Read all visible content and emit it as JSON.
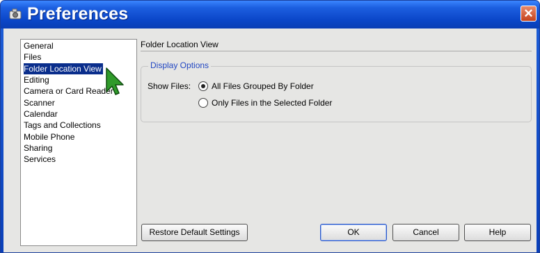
{
  "window": {
    "title": "Preferences",
    "close_glyph": "✕"
  },
  "nav": {
    "items": [
      {
        "label": "General"
      },
      {
        "label": "Files"
      },
      {
        "label": "Folder Location View",
        "selected": true
      },
      {
        "label": "Editing"
      },
      {
        "label": "Camera or Card Reader"
      },
      {
        "label": "Scanner"
      },
      {
        "label": "Calendar"
      },
      {
        "label": "Tags and Collections"
      },
      {
        "label": "Mobile Phone"
      },
      {
        "label": "Sharing"
      },
      {
        "label": "Services"
      }
    ]
  },
  "pane": {
    "title": "Folder Location View",
    "group_label": "Display Options",
    "show_files_label": "Show Files:",
    "options": [
      {
        "label": "All Files Grouped By Folder",
        "checked": true
      },
      {
        "label": "Only Files in the Selected Folder",
        "checked": false
      }
    ]
  },
  "buttons": {
    "restore": "Restore Default Settings",
    "ok": "OK",
    "cancel": "Cancel",
    "help": "Help"
  },
  "colors": {
    "titlebar": "#0b46c8",
    "selection": "#0a2e8c",
    "group_label": "#2146c2",
    "close": "#c4421c"
  },
  "icons": {
    "app": "camera-icon",
    "close": "close-icon",
    "pointer": "mouse-pointer-icon"
  }
}
